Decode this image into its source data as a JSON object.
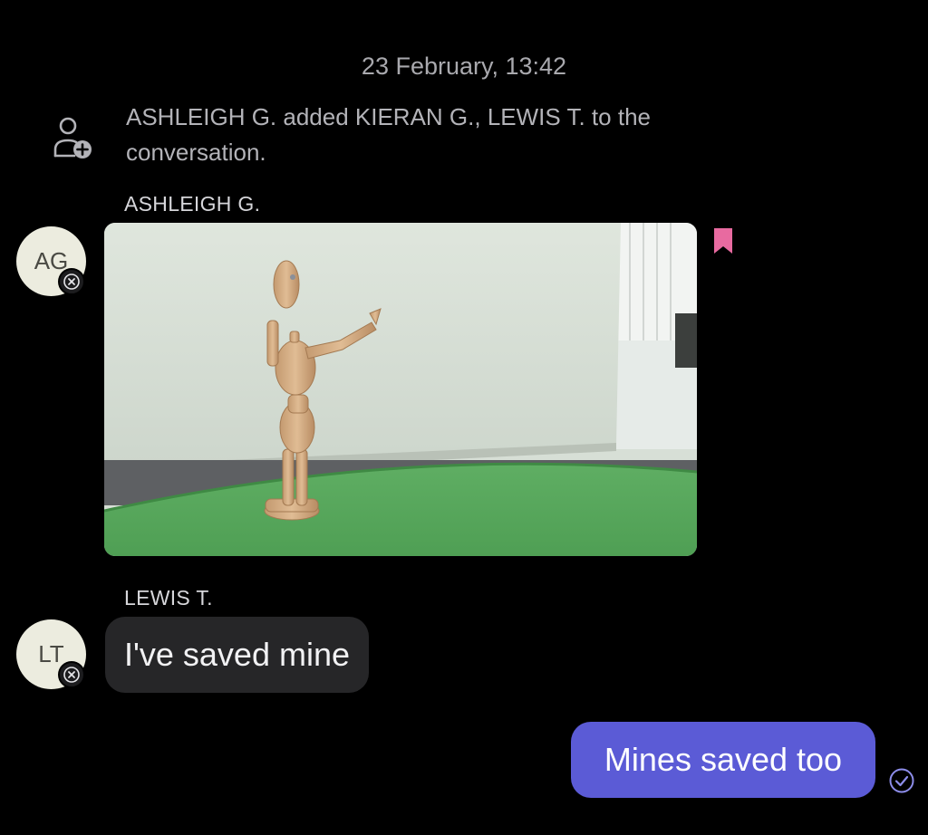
{
  "conversation": {
    "date_divider": "23 February, 13:42",
    "system_event": {
      "icon": "person-add-icon",
      "text": "ASHLEIGH G. added KIERAN G., LEWIS T. to the conversation."
    },
    "messages": [
      {
        "sender": "ASHLEIGH G.",
        "initials": "AG",
        "type": "image",
        "image_description_icon": "photo",
        "bookmarked": true,
        "bookmark_color": "#e86aa0",
        "avatar_badge_icon": "close-circle-icon"
      },
      {
        "sender": "LEWIS T.",
        "initials": "LT",
        "type": "text",
        "text": "I've saved mine",
        "avatar_badge_icon": "close-circle-icon"
      },
      {
        "sender": "me",
        "type": "text",
        "text": "Mines saved too",
        "status_icon": "check-circle-icon",
        "bubble_color": "#5b5bd6"
      }
    ]
  }
}
